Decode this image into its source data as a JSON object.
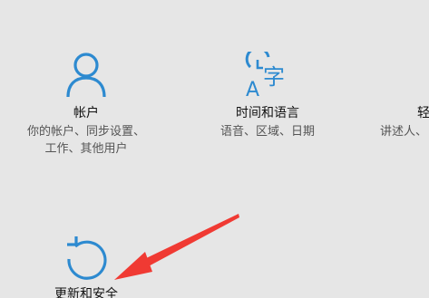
{
  "accent_color": "#2d8ad0",
  "annotation_color": "#f03a33",
  "tiles": {
    "accounts": {
      "icon": "person-icon",
      "title": "帐户",
      "desc_line1": "你的帐户、同步设置、",
      "desc_line2": "工作、其他用户"
    },
    "time_language": {
      "icon": "time-language-icon",
      "title": "时间和语言",
      "desc_line1": "语音、区域、日期"
    },
    "ease_of_access": {
      "icon": "ease-of-access-icon",
      "title": "轻",
      "desc_line1": "讲述人、"
    },
    "update_security": {
      "icon": "refresh-icon",
      "title": "更新和安全"
    }
  },
  "annotation": {
    "icon": "red-arrow-icon"
  }
}
